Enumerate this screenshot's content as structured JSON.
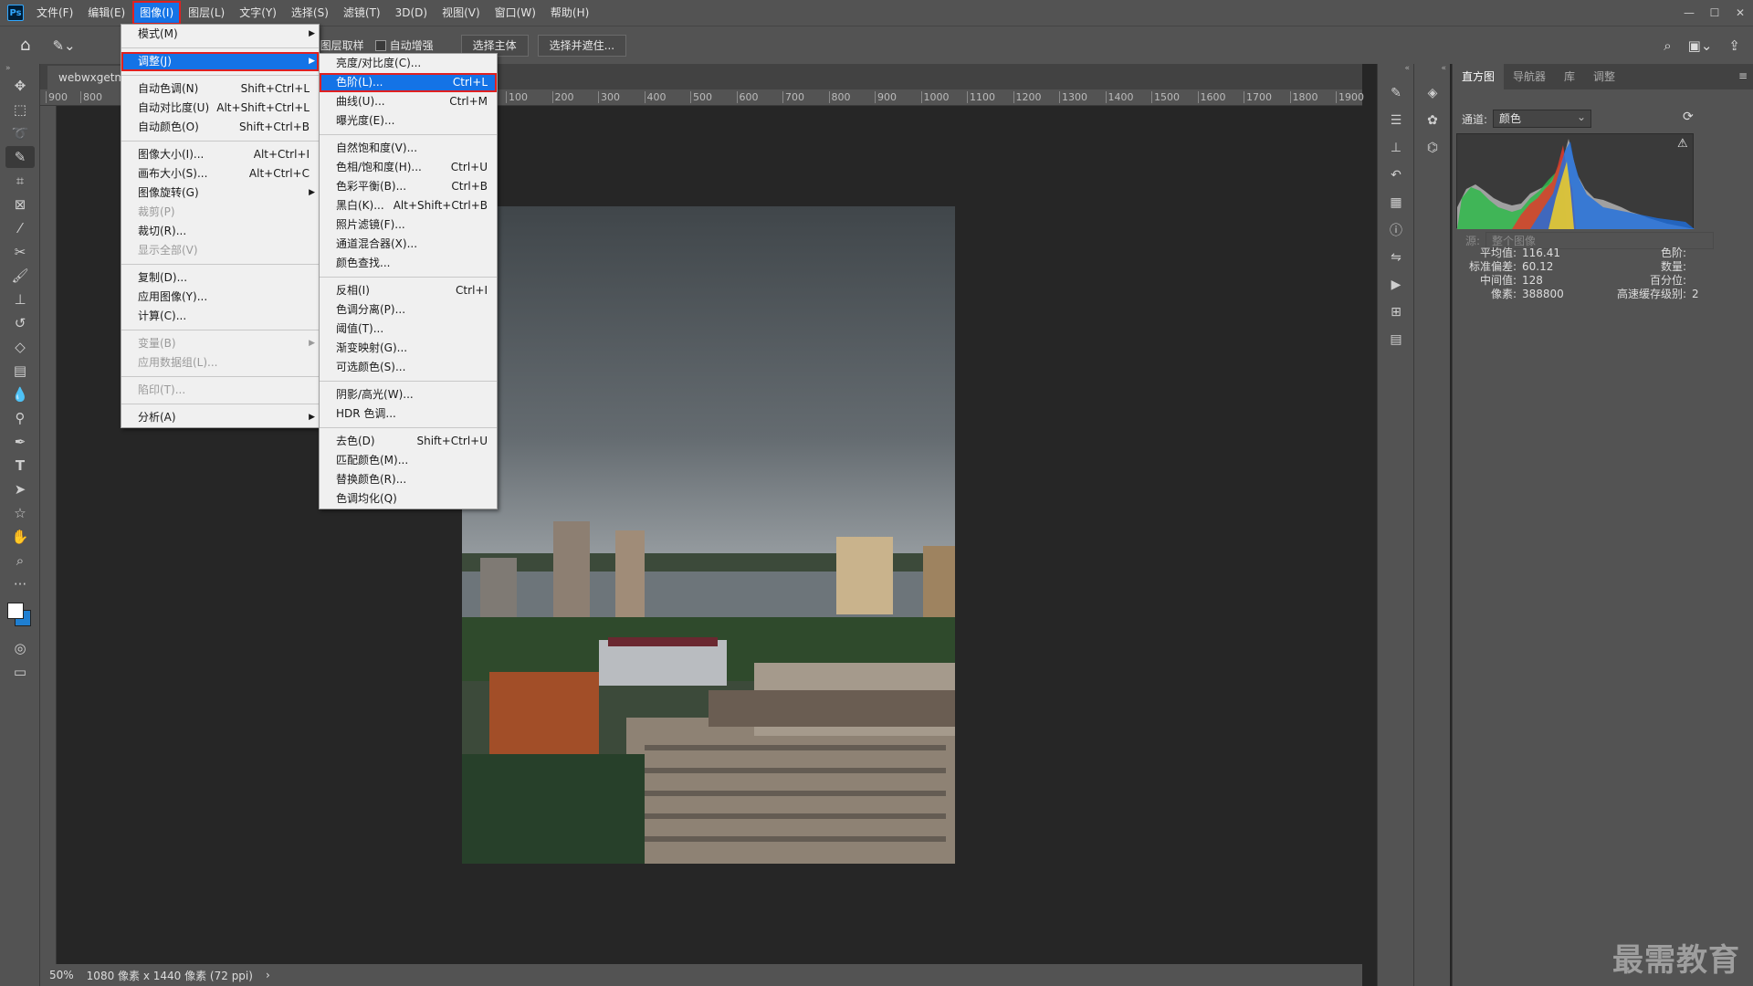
{
  "menubar": {
    "items": [
      "文件(F)",
      "编辑(E)",
      "图像(I)",
      "图层(L)",
      "文字(Y)",
      "选择(S)",
      "滤镜(T)",
      "3D(D)",
      "视图(V)",
      "窗口(W)",
      "帮助(H)"
    ],
    "active_index": 2,
    "window_controls": [
      "—",
      "☐",
      "✕"
    ]
  },
  "options": {
    "sample_all_layers": "对所有图层取样",
    "auto_enhance": "自动增强",
    "select_subject": "选择主体",
    "select_and_mask": "选择并遮住..."
  },
  "document": {
    "tab_title": "webwxgetms",
    "ruler_ticks": [
      "900",
      "800",
      "100",
      "200",
      "300",
      "400",
      "500",
      "600",
      "700",
      "800",
      "900",
      "1000",
      "1100",
      "1200",
      "1300",
      "1400",
      "1500",
      "1600",
      "1700",
      "1800",
      "1900"
    ],
    "zoom": "50%",
    "size_info": "1080 像素 x 1440 像素 (72 ppi)"
  },
  "image_menu": [
    {
      "label": "模式(M)",
      "shortcut": "",
      "submenu": true
    },
    {
      "sep": true
    },
    {
      "label": "调整(J)",
      "shortcut": "",
      "submenu": true,
      "highlight": true,
      "redbox": true
    },
    {
      "sep": true
    },
    {
      "label": "自动色调(N)",
      "shortcut": "Shift+Ctrl+L"
    },
    {
      "label": "自动对比度(U)",
      "shortcut": "Alt+Shift+Ctrl+L"
    },
    {
      "label": "自动颜色(O)",
      "shortcut": "Shift+Ctrl+B"
    },
    {
      "sep": true
    },
    {
      "label": "图像大小(I)...",
      "shortcut": "Alt+Ctrl+I"
    },
    {
      "label": "画布大小(S)...",
      "shortcut": "Alt+Ctrl+C"
    },
    {
      "label": "图像旋转(G)",
      "shortcut": "",
      "submenu": true
    },
    {
      "label": "裁剪(P)",
      "shortcut": "",
      "disabled": true
    },
    {
      "label": "裁切(R)...",
      "shortcut": ""
    },
    {
      "label": "显示全部(V)",
      "shortcut": "",
      "disabled": true
    },
    {
      "sep": true
    },
    {
      "label": "复制(D)...",
      "shortcut": ""
    },
    {
      "label": "应用图像(Y)...",
      "shortcut": ""
    },
    {
      "label": "计算(C)...",
      "shortcut": ""
    },
    {
      "sep": true
    },
    {
      "label": "变量(B)",
      "shortcut": "",
      "submenu": true,
      "disabled": true
    },
    {
      "label": "应用数据组(L)...",
      "shortcut": "",
      "disabled": true
    },
    {
      "sep": true
    },
    {
      "label": "陷印(T)...",
      "shortcut": "",
      "disabled": true
    },
    {
      "sep": true
    },
    {
      "label": "分析(A)",
      "shortcut": "",
      "submenu": true
    }
  ],
  "adjust_menu": [
    {
      "label": "亮度/对比度(C)...",
      "shortcut": ""
    },
    {
      "label": "色阶(L)...",
      "shortcut": "Ctrl+L",
      "highlight": true,
      "redbox": true
    },
    {
      "label": "曲线(U)...",
      "shortcut": "Ctrl+M"
    },
    {
      "label": "曝光度(E)...",
      "shortcut": ""
    },
    {
      "sep": true
    },
    {
      "label": "自然饱和度(V)...",
      "shortcut": ""
    },
    {
      "label": "色相/饱和度(H)...",
      "shortcut": "Ctrl+U"
    },
    {
      "label": "色彩平衡(B)...",
      "shortcut": "Ctrl+B"
    },
    {
      "label": "黑白(K)...",
      "shortcut": "Alt+Shift+Ctrl+B"
    },
    {
      "label": "照片滤镜(F)...",
      "shortcut": ""
    },
    {
      "label": "通道混合器(X)...",
      "shortcut": ""
    },
    {
      "label": "颜色查找...",
      "shortcut": ""
    },
    {
      "sep": true
    },
    {
      "label": "反相(I)",
      "shortcut": "Ctrl+I"
    },
    {
      "label": "色调分离(P)...",
      "shortcut": ""
    },
    {
      "label": "阈值(T)...",
      "shortcut": ""
    },
    {
      "label": "渐变映射(G)...",
      "shortcut": ""
    },
    {
      "label": "可选颜色(S)...",
      "shortcut": ""
    },
    {
      "sep": true
    },
    {
      "label": "阴影/高光(W)...",
      "shortcut": ""
    },
    {
      "label": "HDR 色调...",
      "shortcut": ""
    },
    {
      "sep": true
    },
    {
      "label": "去色(D)",
      "shortcut": "Shift+Ctrl+U"
    },
    {
      "label": "匹配颜色(M)...",
      "shortcut": ""
    },
    {
      "label": "替换颜色(R)...",
      "shortcut": ""
    },
    {
      "label": "色调均化(Q)",
      "shortcut": ""
    }
  ],
  "panel": {
    "tabs": [
      "直方图",
      "导航器",
      "库",
      "调整"
    ],
    "active_tab": 0,
    "channel_label": "通道:",
    "channel_value": "颜色",
    "source_label": "源:",
    "source_value": "整个图像",
    "stats": {
      "mean_label": "平均值:",
      "mean": "116.41",
      "std_label": "标准偏差:",
      "std": "60.12",
      "median_label": "中间值:",
      "median": "128",
      "pixels_label": "像素:",
      "pixels": "388800",
      "level_label": "色阶:",
      "level": "",
      "count_label": "数量:",
      "count": "",
      "percentile_label": "百分位:",
      "percentile": "",
      "cache_label": "高速缓存级别:",
      "cache": "2"
    }
  },
  "watermark": "最需教育",
  "colors": {
    "accent": "#1473e6",
    "highlight_border": "#e02020"
  }
}
